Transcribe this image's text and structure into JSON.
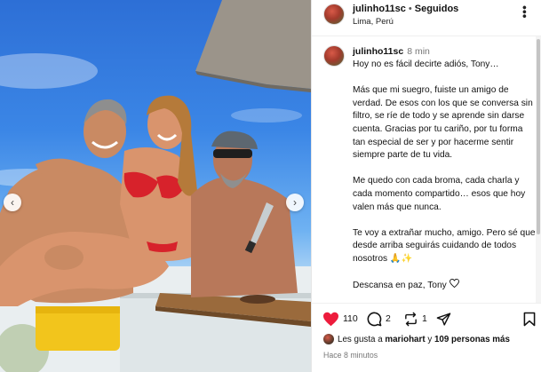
{
  "post": {
    "username": "julinho11sc",
    "separator": "•",
    "follow_status": "Seguidos",
    "location": "Lima, Perú",
    "more_label": "•••"
  },
  "caption": {
    "username": "julinho11sc",
    "time": "8 min",
    "paragraphs": [
      "Hoy no es fácil decirte adiós, Tony…",
      "Más que mi suegro, fuiste un amigo de verdad. De esos con los que se conversa sin filtro, se ríe de todo y se aprende sin darse cuenta. Gracias por tu cariño, por tu forma tan especial de ser y por hacerme sentir siempre parte de tu vida.",
      "Me quedo con cada broma, cada charla y cada momento compartido… esos que hoy valen más que nunca.",
      "Te voy a extrañar mucho, amigo. Pero sé que desde arriba seguirás cuidando de todos nosotros 🙏✨"
    ],
    "closing": "Descansa en paz, Tony"
  },
  "actions": {
    "like_count": "110",
    "comment_count": "2",
    "share_count": "1"
  },
  "likes": {
    "prefix": "Les gusta a",
    "user": "mariohart",
    "connector": "y",
    "others": "109 personas más"
  },
  "timestamp": "Hace 8 minutos",
  "carousel": {
    "prev": "‹",
    "next": "›"
  },
  "icons": {
    "like": "heart-filled-icon",
    "comment": "comment-bubble-icon",
    "share": "repost-icon",
    "send": "send-icon",
    "save": "bookmark-icon"
  },
  "colors": {
    "like_red": "#ed1c3c",
    "sky": "#3b86e6"
  }
}
